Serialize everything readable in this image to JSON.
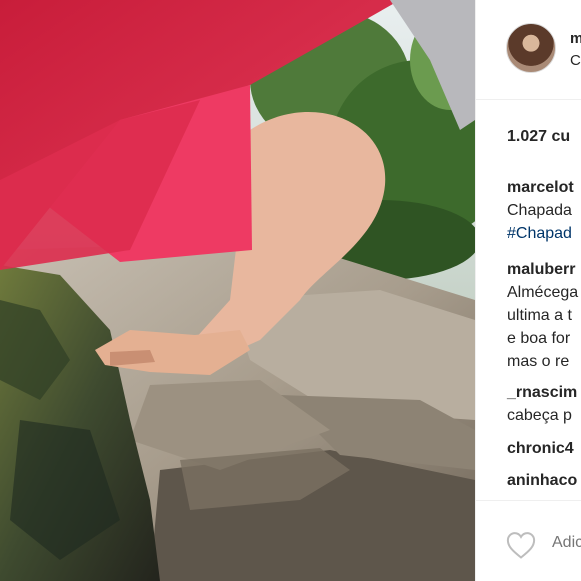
{
  "post": {
    "author": {
      "username": "m",
      "location": "C"
    },
    "likes_text": "1.027 cu",
    "comments": [
      {
        "username": "marcelot",
        "lines": [
          "Chapada",
          "#Chapad"
        ]
      },
      {
        "username": "maluberr",
        "lines": [
          "Almécega",
          "ultima a t",
          "e boa for",
          "mas o re"
        ]
      },
      {
        "username": "_rnascim",
        "lines": [
          "cabeça p"
        ]
      },
      {
        "username": "chronic4",
        "lines": []
      },
      {
        "username": "aninhaco",
        "lines": []
      }
    ],
    "add_comment_placeholder": "Adic",
    "icons": {
      "like": "heart-outline-icon"
    }
  }
}
